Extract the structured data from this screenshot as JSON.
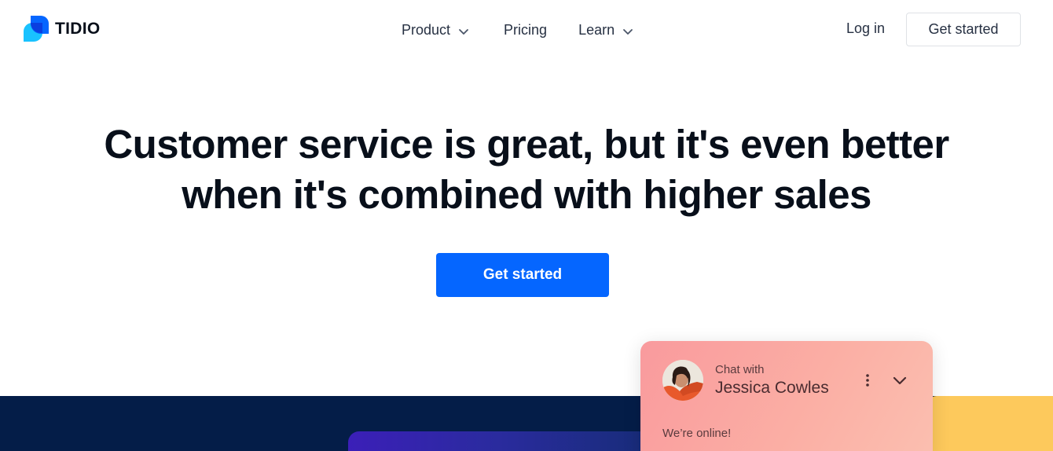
{
  "brand": {
    "name": "TIDIO",
    "accent": "#0566ff"
  },
  "nav": {
    "items": [
      {
        "label": "Product",
        "icon": "chevron-down-icon"
      },
      {
        "label": "Pricing"
      },
      {
        "label": "Learn",
        "icon": "chevron-down-icon"
      }
    ],
    "login_label": "Log in",
    "cta_label": "Get started"
  },
  "hero": {
    "title_line1_regular": "Customer service is great, but it's ",
    "title_line1_bold": "even better",
    "title_line2": "when it's combined with higher sales",
    "cta_label": "Get started"
  },
  "chat": {
    "prefix": "Chat with",
    "agent_name": "Jessica Cowles",
    "status": "We’re online!",
    "icons": [
      "avatar",
      "more-vertical-icon",
      "chevron-down-icon"
    ]
  },
  "colors": {
    "band_background": "#041d48",
    "chat_gradient_start": "#f99a9d",
    "band_yellow": "#fdc95c"
  }
}
